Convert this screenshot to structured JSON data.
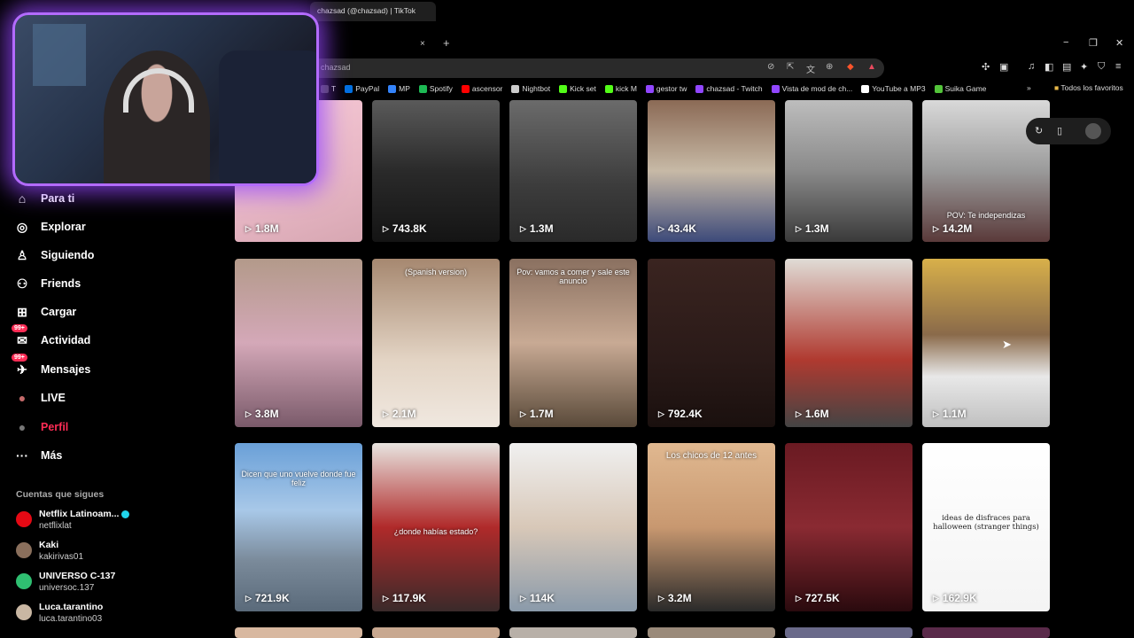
{
  "browser": {
    "tab_title": "chazsad (@chazsad) | TikTok",
    "tab_close": "×",
    "new_tab": "+",
    "address": "chazsad",
    "win_min": "−",
    "win_max": "❐",
    "win_close": "✕",
    "bookmarks": [
      {
        "label": "T",
        "color": "#444"
      },
      {
        "label": "PayPal",
        "color": "#0070e0"
      },
      {
        "label": "MP",
        "color": "#3483fa"
      },
      {
        "label": "Spotify",
        "color": "#1db954"
      },
      {
        "label": "ascensor",
        "color": "#ff0000"
      },
      {
        "label": "Nightbot",
        "color": "#cccccc"
      },
      {
        "label": "Kick set",
        "color": "#53fc18"
      },
      {
        "label": "kick M",
        "color": "#53fc18"
      },
      {
        "label": "gestor tw",
        "color": "#9146ff"
      },
      {
        "label": "chazsad - Twitch",
        "color": "#9146ff"
      },
      {
        "label": "Vista de mod de ch...",
        "color": "#9146ff"
      },
      {
        "label": "YouTube a MP3",
        "color": "#ffffff"
      },
      {
        "label": "Suika Game",
        "color": "#53c43a"
      }
    ],
    "bookmarks_more": "»",
    "all_favorites": "Todos los favoritos"
  },
  "sidebar": {
    "items": [
      {
        "label": "Para ti",
        "icon": "home-icon",
        "glyph": "⌂"
      },
      {
        "label": "Explorar",
        "icon": "compass-icon",
        "glyph": "◎"
      },
      {
        "label": "Siguiendo",
        "icon": "following-icon",
        "glyph": "♙"
      },
      {
        "label": "Friends",
        "icon": "friends-icon",
        "glyph": "⚇"
      },
      {
        "label": "Cargar",
        "icon": "upload-icon",
        "glyph": "⊞"
      },
      {
        "label": "Actividad",
        "icon": "activity-icon",
        "glyph": "✉",
        "badge": "99+"
      },
      {
        "label": "Mensajes",
        "icon": "messages-icon",
        "glyph": "✈",
        "badge": "99+"
      },
      {
        "label": "LIVE",
        "icon": "live-icon",
        "glyph": "●"
      },
      {
        "label": "Perfil",
        "icon": "profile-avatar-icon",
        "glyph": "●"
      },
      {
        "label": "Más",
        "icon": "more-icon",
        "glyph": "···"
      }
    ],
    "following_title": "Cuentas que sigues",
    "following": [
      {
        "name": "Netflix Latinoam...",
        "handle": "netflixlat",
        "avatar_color": "#e50914",
        "verified": true
      },
      {
        "name": "Kaki",
        "handle": "kakirivas01",
        "avatar_color": "#8a6f5c",
        "verified": false
      },
      {
        "name": "UNIVERSO C-137",
        "handle": "universoc.137",
        "avatar_color": "#2fbf71",
        "verified": false
      },
      {
        "name": "Luca.tarantino",
        "handle": "luca.tarantino03",
        "avatar_color": "#c9b7a3",
        "verified": false
      }
    ]
  },
  "videos": [
    {
      "views": "1.8M",
      "bg": "linear-gradient(160deg,#f6c9d6,#e7b6c4 60%,#d7a7b2)",
      "caption": ""
    },
    {
      "views": "743.8K",
      "bg": "linear-gradient(180deg,#5a5a5a,#2a2a2a 50%,#141414)",
      "caption": ""
    },
    {
      "views": "1.3M",
      "bg": "linear-gradient(180deg,#6b6b6b,#3c3c3c 60%,#2a2a2a)",
      "caption": ""
    },
    {
      "views": "43.4K",
      "bg": "linear-gradient(180deg,#8b6a55,#c7b9a6 50%,#3d4a7a)",
      "caption": ""
    },
    {
      "views": "1.3M",
      "bg": "linear-gradient(180deg,#bdbdbd,#8a8a8a 50%,#3a3a3a)",
      "caption": ""
    },
    {
      "views": "14.2M",
      "bg": "linear-gradient(180deg,#d9d9d9,#9a9a9a 50%,#5a3a3a)",
      "caption": "POV: Te independizas"
    },
    {
      "views": "3.8M",
      "bg": "linear-gradient(180deg,#b39a8a,#d4a8b8 50%,#7a5a6a)",
      "caption": ""
    },
    {
      "views": "2.1M",
      "bg": "linear-gradient(180deg,#a68870,#e3d4c4 60%,#f0e8e0)",
      "caption": "(Spanish version)"
    },
    {
      "views": "1.7M",
      "bg": "linear-gradient(180deg,#8a7060,#c8aa94 50%,#5a4a3a)",
      "caption": "Pov: vamos a comer y sale este anuncio"
    },
    {
      "views": "792.4K",
      "bg": "linear-gradient(180deg,#3a2420,#2a1a18 60%,#1a100e)",
      "caption": ""
    },
    {
      "views": "1.6M",
      "bg": "linear-gradient(180deg,#e0dcd6,#b03a30 60%,#444)",
      "caption": ""
    },
    {
      "views": "1.1M",
      "bg": "linear-gradient(180deg,#d8b04a,#8a6a4a 45%,#e8e8e8 70%,#c0c0c0)",
      "caption": ""
    },
    {
      "views": "721.9K",
      "bg": "linear-gradient(180deg,#6aa0d8,#a8c8e8 40%,#7a8a9a 70%,#5a6a7a)",
      "caption": "Dicen que uno vuelve donde fue feliz"
    },
    {
      "views": "117.9K",
      "bg": "linear-gradient(180deg,#e8e4e0,#b02a2a 50%,#3a2a2a)",
      "caption": "¿donde habías estado?"
    },
    {
      "views": "114K",
      "bg": "linear-gradient(180deg,#f0f0f0,#d8c8b8 50%,#8a9aaa)",
      "caption": ""
    },
    {
      "views": "3.2M",
      "bg": "linear-gradient(180deg,#e0b890,#c89870 50%,#2a2a2a)",
      "caption": "Los chicos de 12 antes"
    },
    {
      "views": "727.5K",
      "bg": "linear-gradient(180deg,#6a1a22,#8a2a32 50%,#2a0a0e)",
      "caption": ""
    },
    {
      "views": "162.9K",
      "bg": "linear-gradient(180deg,#ffffff,#f4f4f4)",
      "caption": "ideas de disfraces para halloween (stranger things)"
    }
  ],
  "row4_colors": [
    "#d8b8a0",
    "#c8a890",
    "#b8b0a8",
    "#9a8a7a",
    "#6a6a8a",
    "#5a2a4a"
  ],
  "overlay_icons": [
    "refresh-icon",
    "phone-icon",
    "avatar-icon"
  ]
}
